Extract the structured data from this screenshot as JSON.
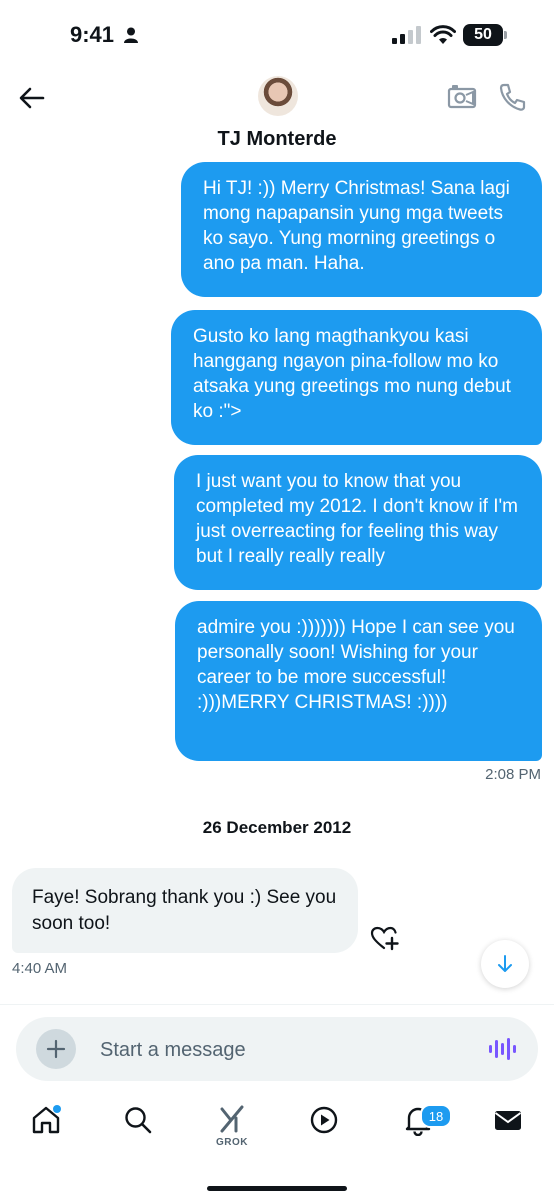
{
  "status_bar": {
    "time": "9:41",
    "battery": "50"
  },
  "header": {
    "contact_name": "TJ Monterde"
  },
  "messages": [
    {
      "direction": "outgoing",
      "text": "Hi TJ! :)) Merry Christmas! Sana lagi mong napapansin yung mga tweets ko sayo. Yung morning greetings o ano pa man. Haha."
    },
    {
      "direction": "outgoing",
      "text": "Gusto ko lang magthankyou kasi hanggang ngayon pina-follow mo ko atsaka yung greetings mo nung debut ko :\">"
    },
    {
      "direction": "outgoing",
      "text": "I just want you to know that you completed my 2012. I don't know if I'm just overreacting for feeling this way but I really really really"
    },
    {
      "direction": "outgoing",
      "text": "admire you :))))))) Hope I can see you personally soon!  Wishing for your career to be more successful! :)))MERRY CHRISTMAS! :))))",
      "time": "2:08 PM"
    },
    {
      "direction": "incoming",
      "text": "Faye! Sobrang thank you :) See you soon too!",
      "time": "4:40 AM"
    }
  ],
  "date_separator": "26 December 2012",
  "composer": {
    "placeholder": "Start a message"
  },
  "tab_bar": {
    "items": [
      "home-icon",
      "search-icon",
      "grok-icon",
      "video-icon",
      "notifications-icon",
      "messages-icon"
    ],
    "grok_label": "GROK",
    "notifications_badge": "18"
  },
  "colors": {
    "accent": "#1d9bf0",
    "incoming_bubble": "#eff3f4",
    "text": "#0f1419",
    "muted": "#536471"
  }
}
